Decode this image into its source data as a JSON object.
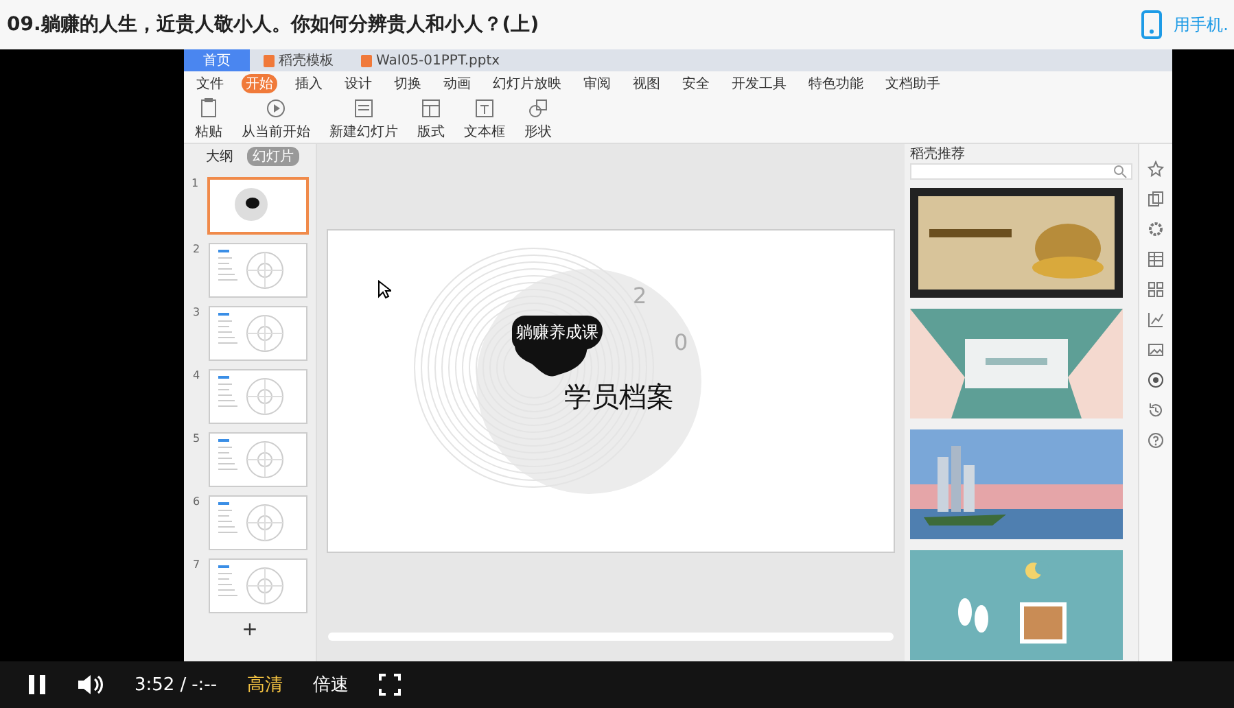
{
  "title": "09.躺赚的人生，近贵人敬小人。你如何分辨贵人和小人？(上)",
  "mobile_link": "用手机.",
  "recording": {
    "app_tabs": [
      {
        "kind": "home",
        "label": "首页",
        "selected": false
      },
      {
        "kind": "doc",
        "label": "稻壳模板",
        "selected": false
      },
      {
        "kind": "doc",
        "label": "WaI05-01PPT.pptx",
        "selected": false
      }
    ],
    "menu": [
      {
        "label": "文件",
        "selected": false
      },
      {
        "label": "开始",
        "selected": true
      },
      {
        "label": "插入",
        "selected": false
      },
      {
        "label": "设计",
        "selected": false
      },
      {
        "label": "切换",
        "selected": false
      },
      {
        "label": "动画",
        "selected": false
      },
      {
        "label": "幻灯片放映",
        "selected": false
      },
      {
        "label": "审阅",
        "selected": false
      },
      {
        "label": "视图",
        "selected": false
      },
      {
        "label": "安全",
        "selected": false
      },
      {
        "label": "开发工具",
        "selected": false
      },
      {
        "label": "特色功能",
        "selected": false
      },
      {
        "label": "文档助手",
        "selected": false
      }
    ],
    "toolbar": [
      "粘贴",
      "从当前开始",
      "新建幻灯片",
      "版式",
      "文本框",
      "形状"
    ],
    "panel_tabs": [
      {
        "label": "大纲",
        "selected": false
      },
      {
        "label": "幻灯片",
        "selected": true
      }
    ],
    "slides": [
      {
        "number": "1",
        "selected": true
      },
      {
        "number": "2",
        "selected": false
      },
      {
        "number": "3",
        "selected": false
      },
      {
        "number": "4",
        "selected": false
      },
      {
        "number": "5",
        "selected": false
      },
      {
        "number": "6",
        "selected": false
      },
      {
        "number": "7",
        "selected": false
      }
    ],
    "add_slide": "+",
    "slide": {
      "subtitle": "躺赚养成课",
      "title": "学员档案",
      "digits": [
        "2",
        "0"
      ]
    },
    "template_panel": {
      "title": "稻壳推荐"
    }
  },
  "player": {
    "playing": true,
    "time": "3:52",
    "separator": "/",
    "duration": "-:--",
    "quality": "高清",
    "speed": "倍速"
  }
}
